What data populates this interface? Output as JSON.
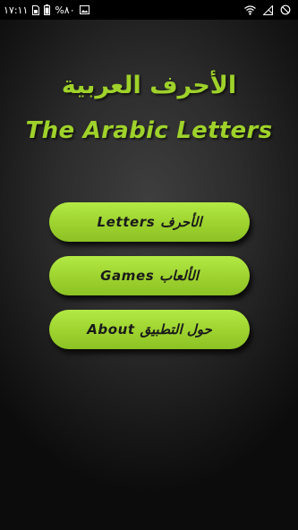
{
  "status_bar": {
    "time": "١٧:١١",
    "battery_percent": "%٨٠",
    "icons": [
      "sim-card-icon",
      "battery-icon",
      "image-icon",
      "wifi-icon",
      "no-signal-icon",
      "alarm-off-icon"
    ]
  },
  "title": {
    "arabic": "الأحرف العربية",
    "english": "The Arabic Letters"
  },
  "menu": {
    "letters_label": "Letters الأحرف",
    "games_label": "Games الألعاب",
    "about_label": "About حول التطبيق"
  },
  "colors": {
    "accent": "#9fd22a",
    "button_fill": "#9dd22f",
    "button_text": "#1a1a1a",
    "status_bar": "#000000",
    "background": "#2c2c2c"
  }
}
